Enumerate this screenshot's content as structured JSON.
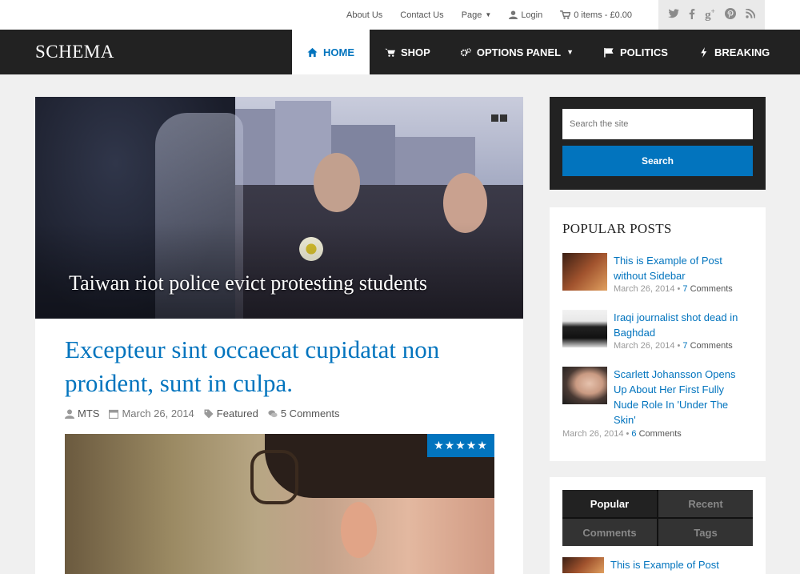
{
  "topbar": {
    "links": [
      "About Us",
      "Contact Us",
      "Page"
    ],
    "login": "Login",
    "cart": "0 items - £0.00",
    "social_icons": [
      "twitter-icon",
      "facebook-icon",
      "google-plus-icon",
      "pinterest-icon",
      "rss-icon"
    ]
  },
  "site": {
    "logo": "SCHEMA"
  },
  "nav": {
    "items": [
      {
        "label": "HOME",
        "icon": "home-icon"
      },
      {
        "label": "SHOP",
        "icon": "cart-icon"
      },
      {
        "label": "OPTIONS PANEL",
        "icon": "cogs-icon"
      },
      {
        "label": "POLITICS",
        "icon": "flag-icon"
      },
      {
        "label": "BREAKING",
        "icon": "bolt-icon"
      }
    ]
  },
  "hero": {
    "title": "Taiwan riot police evict protesting students"
  },
  "post": {
    "title": "Excepteur sint occaecat cupidatat non proident, sunt in culpa.",
    "author": "MTS",
    "date": "March 26, 2014",
    "category": "Featured",
    "comments": "5 Comments",
    "rating_stars": "★★★★★",
    "rating_value": 5
  },
  "search": {
    "placeholder": "Search the site",
    "button": "Search"
  },
  "popular_posts": {
    "title": "POPULAR POSTS",
    "items": [
      {
        "title": "This is Example of Post without Sidebar",
        "date": "March 26, 2014",
        "sep": " • ",
        "count": "7",
        "comments_label": " Comments"
      },
      {
        "title": "Iraqi journalist shot dead in Baghdad",
        "date": "March 26, 2014",
        "sep": " • ",
        "count": "7",
        "comments_label": " Comments"
      },
      {
        "title": "Scarlett Johansson Opens Up About Her First Fully Nude Role In 'Under The Skin'",
        "date": "March 26, 2014",
        "sep": " • ",
        "count": "6",
        "comments_label": " Comments"
      }
    ]
  },
  "tabs_widget": {
    "tabs": [
      "Popular",
      "Recent",
      "Comments",
      "Tags"
    ],
    "first_item": "This is Example of Post"
  },
  "colors": {
    "accent": "#0274be",
    "nav_bg": "#222222"
  }
}
